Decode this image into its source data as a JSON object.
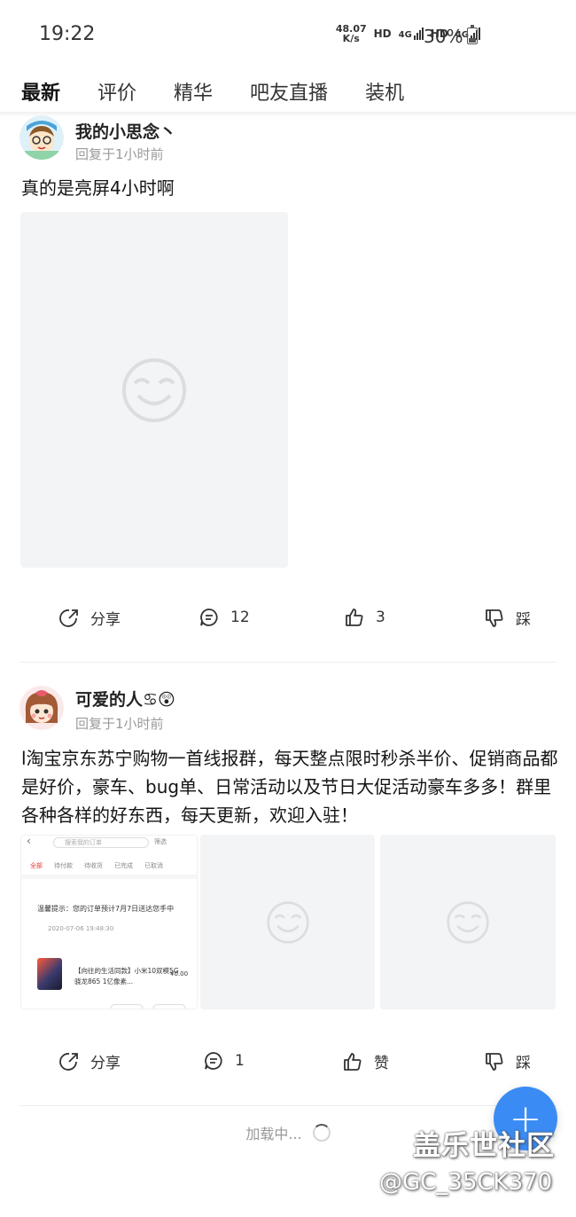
{
  "status_bar": {
    "time": "19:22",
    "net_speed_value": "48.07",
    "net_speed_unit": "K/s",
    "hd1": "HD",
    "net1": "4G",
    "hd2": "HD",
    "net2": "4G",
    "battery_percent": "30%",
    "battery_level": 0.3
  },
  "tabs": [
    {
      "label": "最新",
      "active": true
    },
    {
      "label": "评价",
      "active": false
    },
    {
      "label": "精华",
      "active": false
    },
    {
      "label": "吧友直播",
      "active": false
    },
    {
      "label": "装机",
      "active": false
    }
  ],
  "posts": [
    {
      "username": "我的小思念丶",
      "meta": "回复于1小时前",
      "text": "真的是亮屏4小时啊",
      "actions": {
        "share": "分享",
        "comments": "12",
        "likes": "3",
        "dislike": "踩"
      }
    },
    {
      "username": "可爱的人♋😲",
      "meta": "回复于1小时前",
      "text": "l淘宝京东苏宁购物一首线报群，每天整点限时秒杀半价、促销商品都是好价，豪车、bug单、日常活动以及节日大促活动豪车多多！群里各种各样的好东西，每天更新，欢迎入驻！",
      "actions": {
        "share": "分享",
        "comments": "1",
        "likes": "赞",
        "dislike": "踩"
      },
      "screenshot": {
        "search": "搜索我的订单",
        "filter": "筛选",
        "tabs": [
          "全部",
          "待付款",
          "待收货",
          "已完成",
          "已取消"
        ],
        "tip": "温馨提示：您的订单预计7月7日送达您手中",
        "date": "2020-07-06 19:48:30",
        "product": "【向往的生活同款】小米10双模5G 骁龙865 1亿像素...",
        "price": "¥0.00"
      }
    }
  ],
  "loading_text": "加载中...",
  "fab_label": "+",
  "watermark": {
    "line1": "盖乐世社区",
    "line2": "@GC_35CK370"
  }
}
